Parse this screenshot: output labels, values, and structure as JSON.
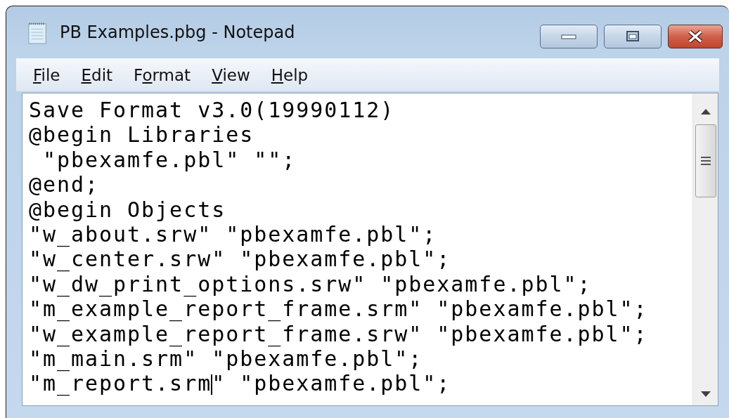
{
  "window": {
    "title": "PB Examples.pbg - Notepad"
  },
  "menu": [
    {
      "accel": "F",
      "after": "ile"
    },
    {
      "accel": "E",
      "after": "dit"
    },
    {
      "before": "F",
      "accel": "o",
      "after": "rmat"
    },
    {
      "accel": "V",
      "after": "iew"
    },
    {
      "accel": "H",
      "after": "elp"
    }
  ],
  "lines": [
    {
      "text": "Save Format v3.0(19990112)",
      "caret": false
    },
    {
      "text": "@begin Libraries",
      "caret": false
    },
    {
      "text": " \"pbexamfe.pbl\" \"\";",
      "caret": false
    },
    {
      "text": "@end;",
      "caret": false
    },
    {
      "text": "@begin Objects",
      "caret": false
    },
    {
      "text": "\"w_about.srw\" \"pbexamfe.pbl\";",
      "caret": false
    },
    {
      "text": "\"w_center.srw\" \"pbexamfe.pbl\";",
      "caret": false
    },
    {
      "text": "\"w_dw_print_options.srw\" \"pbexamfe.pbl\";",
      "caret": false
    },
    {
      "text": "\"m_example_report_frame.srm\" \"pbexamfe.pbl\";",
      "caret": false
    },
    {
      "text": "\"w_example_report_frame.srw\" \"pbexamfe.pbl\";",
      "caret": false
    },
    {
      "text": "\"m_main.srm\" \"pbexamfe.pbl\";",
      "caret": false
    },
    {
      "text": "\"m_report.srm",
      "rest": "\" \"pbexamfe.pbl\";",
      "caret": true
    }
  ]
}
